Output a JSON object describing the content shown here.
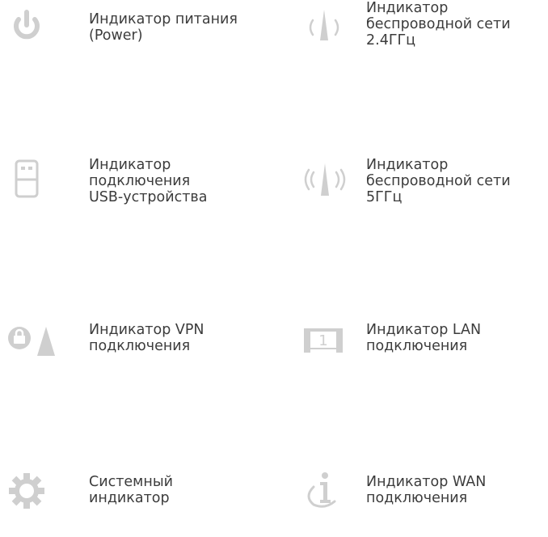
{
  "indicators": [
    {
      "name": "power-indicator",
      "icon": "power-icon",
      "lines": [
        "Индикатор питания",
        "(Power)"
      ]
    },
    {
      "name": "wifi-24-indicator",
      "icon": "wifi-24ghz-icon",
      "lines": [
        "Индикатор",
        "беспроводной сети",
        "2.4ГГц"
      ]
    },
    {
      "name": "usb-indicator",
      "icon": "usb-icon",
      "lines": [
        "Индикатор",
        "подключения",
        "USB-устройства"
      ]
    },
    {
      "name": "wifi-5-indicator",
      "icon": "wifi-5ghz-icon",
      "lines": [
        "Индикатор",
        "беспроводной сети",
        "5ГГц"
      ]
    },
    {
      "name": "vpn-indicator",
      "icon": "vpn-lock-icon",
      "lines": [
        "Индикатор VPN",
        "подключения"
      ]
    },
    {
      "name": "lan-indicator",
      "icon": "lan-port-icon",
      "lines": [
        "Индикатор LAN",
        "подключения"
      ],
      "port_number": "1"
    },
    {
      "name": "system-indicator",
      "icon": "gear-icon",
      "lines": [
        "Системный",
        "индикатор"
      ]
    },
    {
      "name": "wan-indicator",
      "icon": "info-globe-icon",
      "lines": [
        "Индикатор WAN",
        "подключения"
      ]
    }
  ],
  "colors": {
    "icon": "#cfcfcf",
    "text": "#3c3c3c"
  }
}
